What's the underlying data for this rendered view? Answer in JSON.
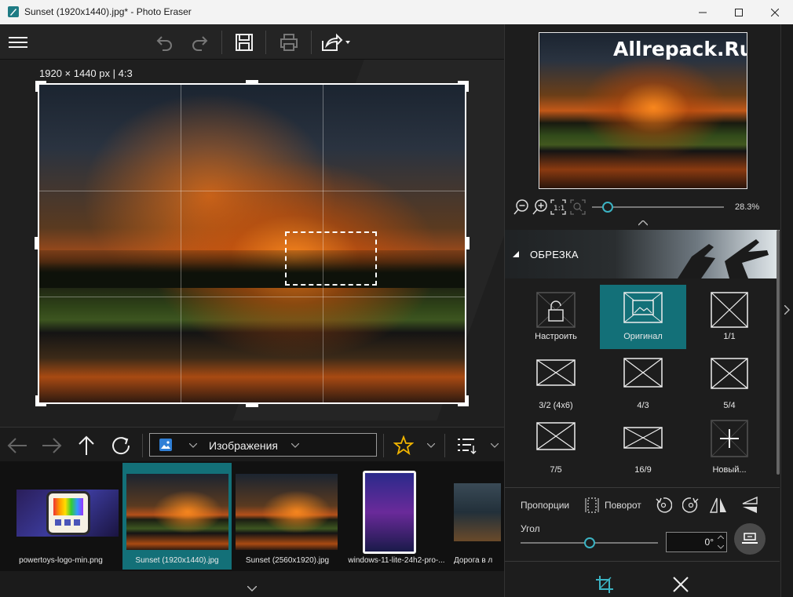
{
  "window": {
    "title": "Sunset (1920x1440).jpg* - Photo Eraser",
    "accent": "#137078"
  },
  "toolbar": {
    "menu_icon": "hamburger-icon",
    "undo_icon": "undo-icon",
    "redo_icon": "redo-icon",
    "save_icon": "save-icon",
    "print_icon": "print-icon",
    "share_icon": "share-icon"
  },
  "canvas": {
    "dimension_label": "1920 × 1440 px | 4:3"
  },
  "navbar": {
    "back_icon": "arrow-left-icon",
    "forward_icon": "arrow-right-icon",
    "up_icon": "arrow-up-icon",
    "refresh_icon": "refresh-icon",
    "folder_label": "Изображения",
    "favorite_icon": "star-icon",
    "sort_icon": "sort-list-icon"
  },
  "filmstrip": [
    {
      "caption": "powertoys-logo-min.png",
      "selected": false
    },
    {
      "caption": "Sunset (1920x1440).jpg",
      "selected": true
    },
    {
      "caption": "Sunset (2560x1920).jpg",
      "selected": false
    },
    {
      "caption": "windows-11-lite-24h2-pro-...",
      "selected": false
    },
    {
      "caption": "Дорога в л",
      "selected": false
    }
  ],
  "preview": {
    "watermark": "Allrepack.Ru",
    "zoom_value": "28.3%",
    "zoom_level": 0.12
  },
  "crop": {
    "header": "ОБРЕЗКА",
    "presets": [
      {
        "label": "Настроить",
        "icon": "lock-icon",
        "selected": false
      },
      {
        "label": "Оригинал",
        "icon": "image-icon",
        "selected": true
      },
      {
        "label": "1/1",
        "icon": "ratio-box-icon",
        "selected": false
      },
      {
        "label": "3/2 (4x6)",
        "icon": "ratio-box-icon",
        "selected": false
      },
      {
        "label": "4/3",
        "icon": "ratio-box-icon",
        "selected": false
      },
      {
        "label": "5/4",
        "icon": "ratio-box-icon",
        "selected": false
      },
      {
        "label": "7/5",
        "icon": "ratio-box-icon",
        "selected": false
      },
      {
        "label": "16/9",
        "icon": "ratio-box-icon",
        "selected": false
      },
      {
        "label": "Новый...",
        "icon": "plus-icon",
        "selected": false
      }
    ],
    "proportions_label": "Пропорции",
    "rotate_label": "Поворот",
    "angle_label": "Угол",
    "angle_value": "0°",
    "angle_slider_level": 0.5
  }
}
